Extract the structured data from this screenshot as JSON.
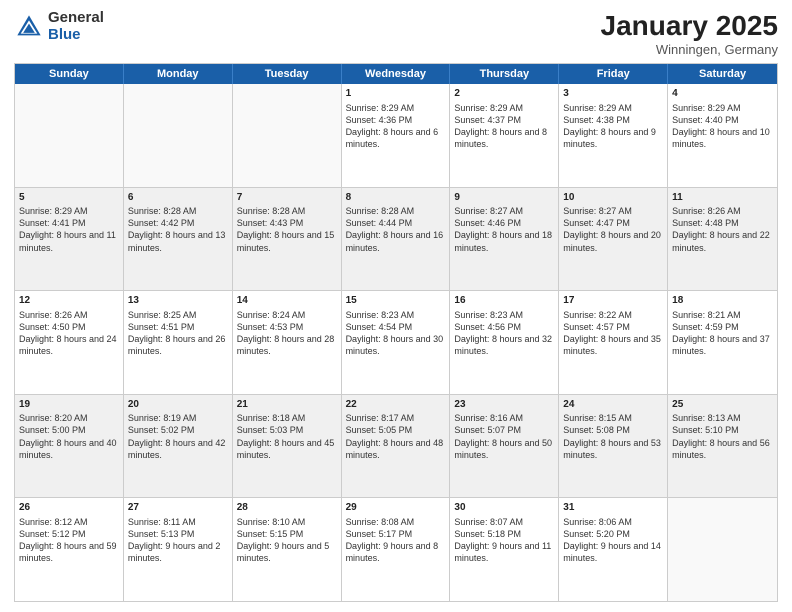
{
  "logo": {
    "general": "General",
    "blue": "Blue"
  },
  "header": {
    "month": "January 2025",
    "location": "Winningen, Germany"
  },
  "weekdays": [
    "Sunday",
    "Monday",
    "Tuesday",
    "Wednesday",
    "Thursday",
    "Friday",
    "Saturday"
  ],
  "rows": [
    [
      {
        "day": "",
        "text": ""
      },
      {
        "day": "",
        "text": ""
      },
      {
        "day": "",
        "text": ""
      },
      {
        "day": "1",
        "text": "Sunrise: 8:29 AM\nSunset: 4:36 PM\nDaylight: 8 hours and 6 minutes."
      },
      {
        "day": "2",
        "text": "Sunrise: 8:29 AM\nSunset: 4:37 PM\nDaylight: 8 hours and 8 minutes."
      },
      {
        "day": "3",
        "text": "Sunrise: 8:29 AM\nSunset: 4:38 PM\nDaylight: 8 hours and 9 minutes."
      },
      {
        "day": "4",
        "text": "Sunrise: 8:29 AM\nSunset: 4:40 PM\nDaylight: 8 hours and 10 minutes."
      }
    ],
    [
      {
        "day": "5",
        "text": "Sunrise: 8:29 AM\nSunset: 4:41 PM\nDaylight: 8 hours and 11 minutes."
      },
      {
        "day": "6",
        "text": "Sunrise: 8:28 AM\nSunset: 4:42 PM\nDaylight: 8 hours and 13 minutes."
      },
      {
        "day": "7",
        "text": "Sunrise: 8:28 AM\nSunset: 4:43 PM\nDaylight: 8 hours and 15 minutes."
      },
      {
        "day": "8",
        "text": "Sunrise: 8:28 AM\nSunset: 4:44 PM\nDaylight: 8 hours and 16 minutes."
      },
      {
        "day": "9",
        "text": "Sunrise: 8:27 AM\nSunset: 4:46 PM\nDaylight: 8 hours and 18 minutes."
      },
      {
        "day": "10",
        "text": "Sunrise: 8:27 AM\nSunset: 4:47 PM\nDaylight: 8 hours and 20 minutes."
      },
      {
        "day": "11",
        "text": "Sunrise: 8:26 AM\nSunset: 4:48 PM\nDaylight: 8 hours and 22 minutes."
      }
    ],
    [
      {
        "day": "12",
        "text": "Sunrise: 8:26 AM\nSunset: 4:50 PM\nDaylight: 8 hours and 24 minutes."
      },
      {
        "day": "13",
        "text": "Sunrise: 8:25 AM\nSunset: 4:51 PM\nDaylight: 8 hours and 26 minutes."
      },
      {
        "day": "14",
        "text": "Sunrise: 8:24 AM\nSunset: 4:53 PM\nDaylight: 8 hours and 28 minutes."
      },
      {
        "day": "15",
        "text": "Sunrise: 8:23 AM\nSunset: 4:54 PM\nDaylight: 8 hours and 30 minutes."
      },
      {
        "day": "16",
        "text": "Sunrise: 8:23 AM\nSunset: 4:56 PM\nDaylight: 8 hours and 32 minutes."
      },
      {
        "day": "17",
        "text": "Sunrise: 8:22 AM\nSunset: 4:57 PM\nDaylight: 8 hours and 35 minutes."
      },
      {
        "day": "18",
        "text": "Sunrise: 8:21 AM\nSunset: 4:59 PM\nDaylight: 8 hours and 37 minutes."
      }
    ],
    [
      {
        "day": "19",
        "text": "Sunrise: 8:20 AM\nSunset: 5:00 PM\nDaylight: 8 hours and 40 minutes."
      },
      {
        "day": "20",
        "text": "Sunrise: 8:19 AM\nSunset: 5:02 PM\nDaylight: 8 hours and 42 minutes."
      },
      {
        "day": "21",
        "text": "Sunrise: 8:18 AM\nSunset: 5:03 PM\nDaylight: 8 hours and 45 minutes."
      },
      {
        "day": "22",
        "text": "Sunrise: 8:17 AM\nSunset: 5:05 PM\nDaylight: 8 hours and 48 minutes."
      },
      {
        "day": "23",
        "text": "Sunrise: 8:16 AM\nSunset: 5:07 PM\nDaylight: 8 hours and 50 minutes."
      },
      {
        "day": "24",
        "text": "Sunrise: 8:15 AM\nSunset: 5:08 PM\nDaylight: 8 hours and 53 minutes."
      },
      {
        "day": "25",
        "text": "Sunrise: 8:13 AM\nSunset: 5:10 PM\nDaylight: 8 hours and 56 minutes."
      }
    ],
    [
      {
        "day": "26",
        "text": "Sunrise: 8:12 AM\nSunset: 5:12 PM\nDaylight: 8 hours and 59 minutes."
      },
      {
        "day": "27",
        "text": "Sunrise: 8:11 AM\nSunset: 5:13 PM\nDaylight: 9 hours and 2 minutes."
      },
      {
        "day": "28",
        "text": "Sunrise: 8:10 AM\nSunset: 5:15 PM\nDaylight: 9 hours and 5 minutes."
      },
      {
        "day": "29",
        "text": "Sunrise: 8:08 AM\nSunset: 5:17 PM\nDaylight: 9 hours and 8 minutes."
      },
      {
        "day": "30",
        "text": "Sunrise: 8:07 AM\nSunset: 5:18 PM\nDaylight: 9 hours and 11 minutes."
      },
      {
        "day": "31",
        "text": "Sunrise: 8:06 AM\nSunset: 5:20 PM\nDaylight: 9 hours and 14 minutes."
      },
      {
        "day": "",
        "text": ""
      }
    ]
  ]
}
